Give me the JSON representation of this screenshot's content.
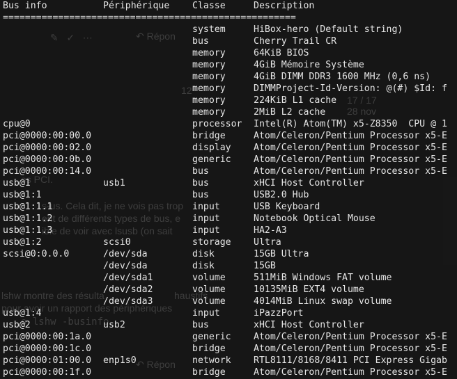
{
  "ghost_page": {
    "reply_top": "Répon",
    "num_12": "12",
    "pagination": "17 / 17",
    "date": "28 nov",
    "pci_fragment": "es PCI.",
    "para1_line1": "s-us. Cela dit, je ne vois pas trop",
    "para1_line2": "ent de différents types de bus, e",
    "para1_line3": "ible de voir avec lsusb (on sait",
    "para2_line1": "lshw montre des résulta",
    "para2_fragment_right": "haustifs",
    "para2_line2": "pour avoir un rapport des périphériques",
    "code": "o lshw -businfo",
    "reply_bottom": "Répon"
  },
  "terminal": {
    "header": {
      "bus_info": "Bus info",
      "device": "Périphérique",
      "class": "Classe",
      "description": "Description"
    },
    "separator": "=====================================================",
    "rows": [
      {
        "bus": "",
        "device": "",
        "class": "system",
        "description": "HiBox-hero (Default string)"
      },
      {
        "bus": "",
        "device": "",
        "class": "bus",
        "description": "Cherry Trail CR"
      },
      {
        "bus": "",
        "device": "",
        "class": "memory",
        "description": "64KiB BIOS"
      },
      {
        "bus": "",
        "device": "",
        "class": "memory",
        "description": "4GiB Mémoire Système"
      },
      {
        "bus": "",
        "device": "",
        "class": "memory",
        "description": "4GiB DIMM DDR3 1600 MHz (0,6 ns)"
      },
      {
        "bus": "",
        "device": "",
        "class": "memory",
        "description": "DIMMProject-Id-Version: @(#) $Id: f"
      },
      {
        "bus": "",
        "device": "",
        "class": "memory",
        "description": "224KiB L1 cache"
      },
      {
        "bus": "",
        "device": "",
        "class": "memory",
        "description": "2MiB L2 cache"
      },
      {
        "bus": "cpu@0",
        "device": "",
        "class": "processor",
        "description": "Intel(R) Atom(TM) x5-Z8350  CPU @ 1"
      },
      {
        "bus": "pci@0000:00:00.0",
        "device": "",
        "class": "bridge",
        "description": "Atom/Celeron/Pentium Processor x5-E"
      },
      {
        "bus": "pci@0000:00:02.0",
        "device": "",
        "class": "display",
        "description": "Atom/Celeron/Pentium Processor x5-E"
      },
      {
        "bus": "pci@0000:00:0b.0",
        "device": "",
        "class": "generic",
        "description": "Atom/Celeron/Pentium Processor x5-E"
      },
      {
        "bus": "pci@0000:00:14.0",
        "device": "",
        "class": "bus",
        "description": "Atom/Celeron/Pentium Processor x5-E"
      },
      {
        "bus": "usb@1",
        "device": "usb1",
        "class": "bus",
        "description": "xHCI Host Controller"
      },
      {
        "bus": "usb@1:1",
        "device": "",
        "class": "bus",
        "description": "USB2.0 Hub"
      },
      {
        "bus": "usb@1:1.1",
        "device": "",
        "class": "input",
        "description": "USB Keyboard"
      },
      {
        "bus": "usb@1:1.2",
        "device": "",
        "class": "input",
        "description": "Notebook Optical Mouse"
      },
      {
        "bus": "usb@1:1.3",
        "device": "",
        "class": "input",
        "description": "HA2-A3"
      },
      {
        "bus": "usb@1:2",
        "device": "scsi0",
        "class": "storage",
        "description": "Ultra"
      },
      {
        "bus": "scsi@0:0.0.0",
        "device": "/dev/sda",
        "class": "disk",
        "description": "15GB Ultra"
      },
      {
        "bus": "",
        "device": "/dev/sda",
        "class": "disk",
        "description": "15GB"
      },
      {
        "bus": "",
        "device": "/dev/sda1",
        "class": "volume",
        "description": "511MiB Windows FAT volume"
      },
      {
        "bus": "",
        "device": "/dev/sda2",
        "class": "volume",
        "description": "10135MiB EXT4 volume"
      },
      {
        "bus": "",
        "device": "/dev/sda3",
        "class": "volume",
        "description": "4014MiB Linux swap volume"
      },
      {
        "bus": "usb@1:4",
        "device": "",
        "class": "input",
        "description": "iPazzPort"
      },
      {
        "bus": "usb@2",
        "device": "usb2",
        "class": "bus",
        "description": "xHCI Host Controller"
      },
      {
        "bus": "pci@0000:00:1a.0",
        "device": "",
        "class": "generic",
        "description": "Atom/Celeron/Pentium Processor x5-E"
      },
      {
        "bus": "pci@0000:00:1c.0",
        "device": "",
        "class": "bridge",
        "description": "Atom/Celeron/Pentium Processor x5-E"
      },
      {
        "bus": "pci@0000:01:00.0",
        "device": "enp1s0",
        "class": "network",
        "description": "RTL8111/8168/8411 PCI Express Gigab"
      },
      {
        "bus": "pci@0000:00:1f.0",
        "device": "",
        "class": "bridge",
        "description": "Atom/Celeron/Pentium Processor x5-E"
      }
    ]
  }
}
